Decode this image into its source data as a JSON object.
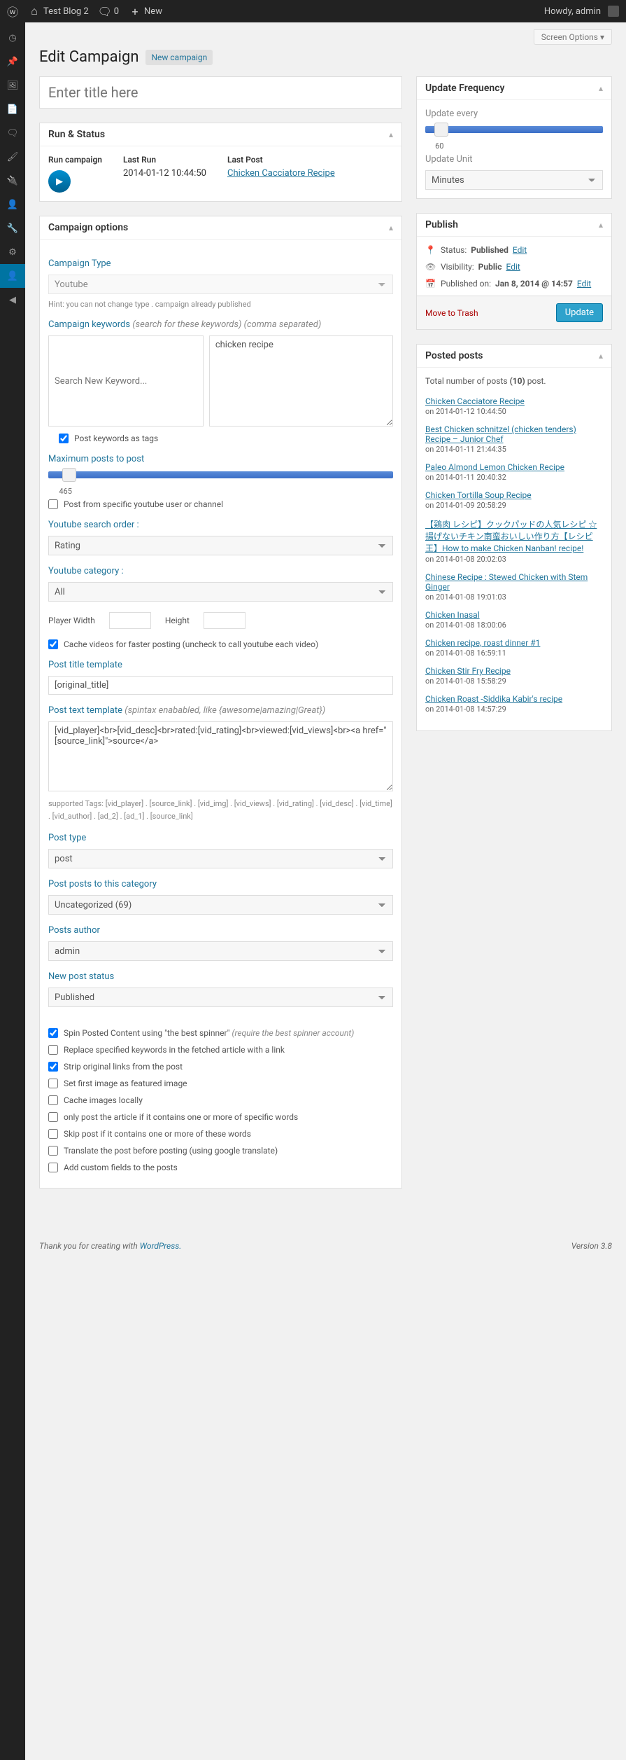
{
  "adminbar": {
    "site": "Test Blog 2",
    "comments": "0",
    "new": "New",
    "howdy": "Howdy, admin"
  },
  "screen_options": "Screen Options ▾",
  "header": {
    "title": "Edit Campaign",
    "new": "New campaign"
  },
  "title_placeholder": "Enter title here",
  "run_status": {
    "title": "Run & Status",
    "run_label": "Run campaign",
    "last_run_label": "Last Run",
    "last_run_value": "2014-01-12 10:44:50",
    "last_post_label": "Last Post",
    "last_post_link": "Chicken Cacciatore Recipe"
  },
  "options": {
    "title": "Campaign options",
    "type_label": "Campaign Type",
    "type_value": "Youtube",
    "type_hint": "Hint: you can not change type . campaign already published",
    "keywords_label": "Campaign keywords",
    "keywords_hint": "(search for these keywords) (comma separated)",
    "keyword_search_placeholder": "Search New Keyword...",
    "keyword_value": "chicken recipe",
    "post_keywords_tags": "Post keywords as tags",
    "max_posts_label": "Maximum posts to post",
    "max_posts_value": "465",
    "post_from_specific": "Post from specific youtube user or channel",
    "search_order_label": "Youtube search order :",
    "search_order_value": "Rating",
    "category_label": "Youtube category :",
    "category_value": "All",
    "player_width": "Player Width",
    "height": "Height",
    "cache_videos": "Cache videos for faster posting (uncheck to call youtube each video)",
    "title_template_label": "Post title template",
    "title_template_value": "[original_title]",
    "text_template_label": "Post text template",
    "text_template_hint": "(spintax enababled, like {awesome|amazing|Great})",
    "text_template_value": "[vid_player]<br>[vid_desc]<br>rated:[vid_rating]<br>viewed:[vid_views]<br><a href=\"[source_link]\">source</a>",
    "supported_tags": "supported Tags: [vid_player] . [source_link] . [vid_img] . [vid_views] . [vid_rating] . [vid_desc] . [vid_time] . [vid_author] . [ad_2] . [ad_1] . [source_link]",
    "post_type_label": "Post type",
    "post_type_value": "post",
    "post_category_label": "Post posts to this category",
    "post_category_value": "Uncategorized (69)",
    "author_label": "Posts author",
    "author_value": "admin",
    "status_label": "New post status",
    "status_value": "Published",
    "spin_label": "Spin Posted Content using \"the best spinner\"",
    "spin_hint": "(require the best spinner account)",
    "replace_keywords": "Replace specified keywords in the fetched article with a link",
    "strip_links": "Strip original links from the post",
    "featured_image": "Set first image as featured image",
    "cache_images": "Cache images locally",
    "only_post_if": "only post the article if it contains one or more of specific words",
    "skip_if": "Skip post if it contains one or more of these words",
    "translate": "Translate the post before posting (using google translate)",
    "custom_fields": "Add custom fields to the posts"
  },
  "update_freq": {
    "title": "Update Frequency",
    "every": "Update every",
    "value": "60",
    "unit_label": "Update Unit",
    "unit_value": "Minutes"
  },
  "publish": {
    "title": "Publish",
    "status_label": "Status:",
    "status_value": "Published",
    "edit": "Edit",
    "visibility_label": "Visibility:",
    "visibility_value": "Public",
    "published_label": "Published on:",
    "published_value": "Jan 8, 2014 @ 14:57",
    "trash": "Move to Trash",
    "update": "Update"
  },
  "posted": {
    "title": "Posted posts",
    "total_prefix": "Total number of posts",
    "total_count": "(10)",
    "total_suffix": "post.",
    "on": "on",
    "items": [
      {
        "title": "Chicken Cacciatore Recipe",
        "date": "2014-01-12 10:44:50"
      },
      {
        "title": "Best Chicken schnitzel (chicken tenders) Recipe – Junior Chef",
        "date": "2014-01-11 21:44:35"
      },
      {
        "title": "Paleo Almond Lemon Chicken Recipe",
        "date": "2014-01-11 20:40:32"
      },
      {
        "title": "Chicken Tortilla Soup Recipe",
        "date": "2014-01-09 20:58:29"
      },
      {
        "title": "【鶏肉 レシピ】クックパッドの人気レシピ ☆揚げないチキン南蛮おいしい作り方【レシピ王】How to make Chicken Nanban! recipe!",
        "date": "2014-01-08 20:02:03"
      },
      {
        "title": "Chinese Recipe : Stewed Chicken with Stem Ginger",
        "date": "2014-01-08 19:01:03"
      },
      {
        "title": "Chicken Inasal",
        "date": "2014-01-08 18:00:06"
      },
      {
        "title": "Chicken recipe, roast dinner #1",
        "date": "2014-01-08 16:59:11"
      },
      {
        "title": "Chicken Stir Fry Recipe",
        "date": "2014-01-08 15:58:29"
      },
      {
        "title": "Chicken Roast -Siddika Kabir's recipe",
        "date": "2014-01-08 14:57:29"
      }
    ]
  },
  "footer": {
    "thank": "Thank you for creating with ",
    "wp": "WordPress.",
    "version": "Version 3.8"
  }
}
